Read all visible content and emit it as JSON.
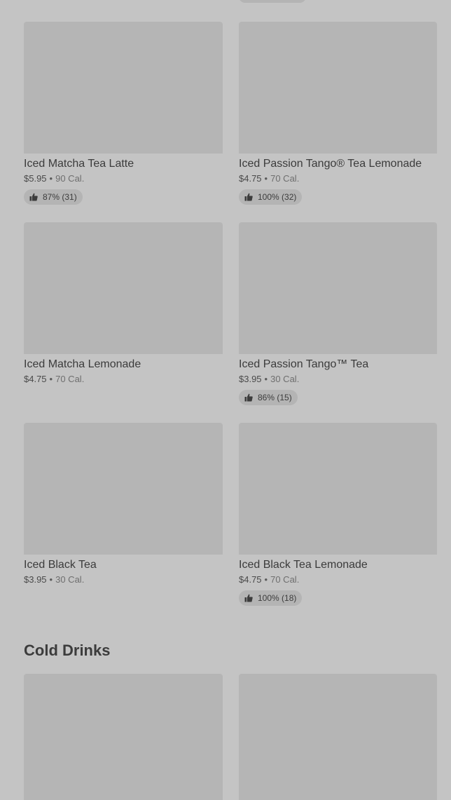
{
  "menu_items": [
    {
      "title": "Iced Matcha Tea Latte",
      "price": "$5.95",
      "separator": "•",
      "calories": "90 Cal.",
      "rating": "87% (31)"
    },
    {
      "title": "Iced Passion Tango® Tea Lemonade",
      "price": "$4.75",
      "separator": "•",
      "calories": "70 Cal.",
      "rating": "100% (32)"
    },
    {
      "title": "Iced Matcha Lemonade",
      "price": "$4.75",
      "separator": "•",
      "calories": "70 Cal.",
      "rating": null
    },
    {
      "title": "Iced Passion Tango™ Tea",
      "price": "$3.95",
      "separator": "•",
      "calories": "30 Cal.",
      "rating": "86% (15)"
    },
    {
      "title": "Iced Black Tea",
      "price": "$3.95",
      "separator": "•",
      "calories": "30 Cal.",
      "rating": null
    },
    {
      "title": "Iced Black Tea Lemonade",
      "price": "$4.75",
      "separator": "•",
      "calories": "70 Cal.",
      "rating": "100% (18)"
    }
  ],
  "cold_drinks": {
    "title": "Cold Drinks"
  },
  "icons": {
    "rating": "thumbs-up-icon"
  },
  "colors": {
    "background": "#c4c4c4",
    "image_placeholder": "#b5b5b5",
    "badge_background": "#b4b4b4",
    "text": "#3b3b3b"
  }
}
